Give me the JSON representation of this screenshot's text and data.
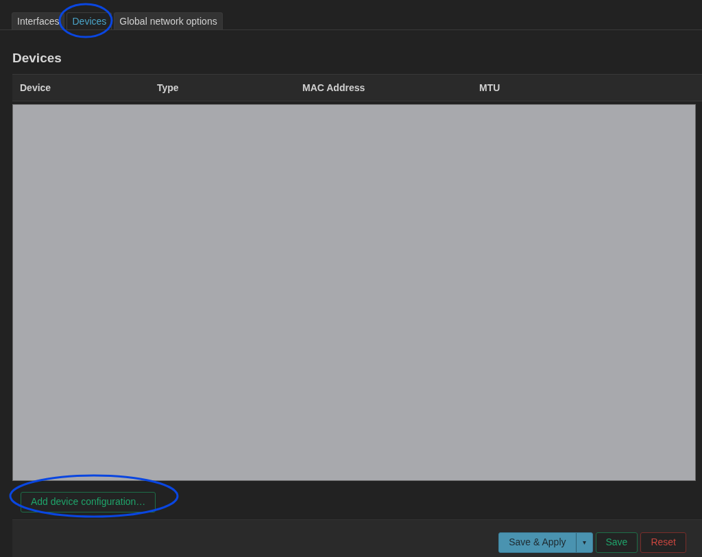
{
  "tabs": [
    {
      "label": "Interfaces",
      "selected": false
    },
    {
      "label": "Devices",
      "selected": true
    },
    {
      "label": "Global network options",
      "selected": false
    }
  ],
  "section": {
    "title": "Devices"
  },
  "table": {
    "columns": [
      "Device",
      "Type",
      "MAC Address",
      "MTU"
    ]
  },
  "add_button": "Add device configuration…",
  "footer": {
    "save_apply": "Save & Apply",
    "dropdown": "▾",
    "save": "Save",
    "reset": "Reset"
  }
}
